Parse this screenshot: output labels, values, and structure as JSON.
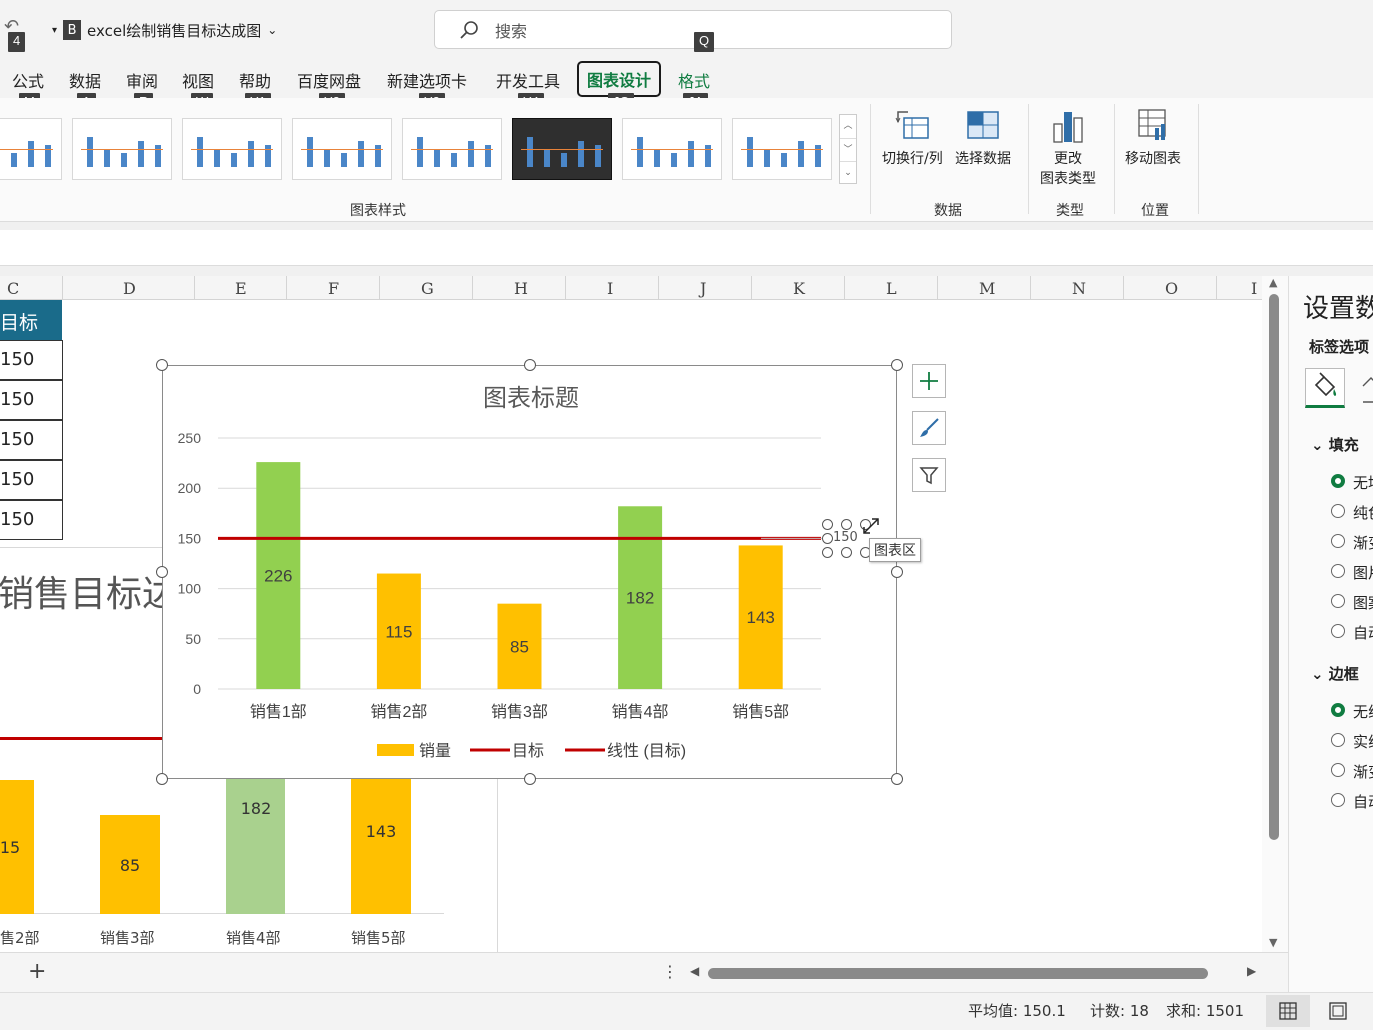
{
  "title_bar": {
    "doc_badge": "B",
    "doc_name": "excel绘制销售目标达成图",
    "search_placeholder": "搜索",
    "qat_keytip": "4",
    "search_keytip": "Q"
  },
  "ribbon_tabs": [
    {
      "label": "公式",
      "keytip": "M"
    },
    {
      "label": "数据",
      "keytip": "A"
    },
    {
      "label": "审阅",
      "keytip": "R"
    },
    {
      "label": "视图",
      "keytip": "W"
    },
    {
      "label": "帮助",
      "keytip": "Y1"
    },
    {
      "label": "百度网盘",
      "keytip": "Y2"
    },
    {
      "label": "新建选项卡",
      "keytip": "Y3"
    },
    {
      "label": "开发工具",
      "keytip": "Y4"
    },
    {
      "label": "图表设计",
      "keytip": "JC",
      "active": true
    },
    {
      "label": "格式",
      "keytip": "JA"
    }
  ],
  "ribbon": {
    "chart_styles_label": "图表样式",
    "switch_row_col": "切换行/列",
    "select_data": "选择数据",
    "data_group": "数据",
    "change_type_line1": "更改",
    "change_type_line2": "图表类型",
    "type_group": "类型",
    "move_chart": "移动图表",
    "location_group": "位置"
  },
  "columns": [
    "C",
    "D",
    "E",
    "F",
    "G",
    "H",
    "I",
    "J",
    "K",
    "L",
    "M",
    "N",
    "O",
    "I"
  ],
  "table": {
    "header": "目标",
    "values": [
      "150",
      "150",
      "150",
      "150",
      "150"
    ]
  },
  "background_chart": {
    "title": "销售目标达",
    "bar_labels": [
      "15",
      "85",
      "182",
      "143"
    ],
    "categories": [
      "售2部",
      "销售3部",
      "销售4部",
      "销售5部"
    ]
  },
  "chart_data": {
    "type": "bar",
    "title": "图表标题",
    "categories": [
      "销售1部",
      "销售2部",
      "销售3部",
      "销售4部",
      "销售5部"
    ],
    "series": [
      {
        "name": "销量",
        "values": [
          226,
          115,
          85,
          182,
          143
        ],
        "colors": [
          "#92d050",
          "#ffc000",
          "#ffc000",
          "#92d050",
          "#ffc000"
        ]
      },
      {
        "name": "目标",
        "values": [
          150,
          150,
          150,
          150,
          150
        ],
        "color": "#c00000"
      },
      {
        "name": "线性 (目标)",
        "color": "#c00000"
      }
    ],
    "yticks": [
      "0",
      "50",
      "100",
      "150",
      "200",
      "250"
    ],
    "ylim": [
      0,
      250
    ],
    "end_label": "150",
    "legend_position": "bottom"
  },
  "tooltip": "图表区",
  "format_pane": {
    "title": "设置数",
    "subtitle": "标签选项",
    "fill_section": "填充",
    "fill_options": [
      "无填",
      "纯色",
      "渐变",
      "图片",
      "图案",
      "自动"
    ],
    "border_section": "边框",
    "border_options": [
      "无线",
      "实线",
      "渐变",
      "自动"
    ]
  },
  "status": {
    "average": "平均值: 150.1",
    "count": "计数: 18",
    "sum": "求和: 1501"
  },
  "colors": {
    "accent": "#107c41",
    "table_header": "#1a6b8a",
    "target_line": "#c00000",
    "bar_green": "#92d050",
    "bar_orange": "#ffc000"
  }
}
